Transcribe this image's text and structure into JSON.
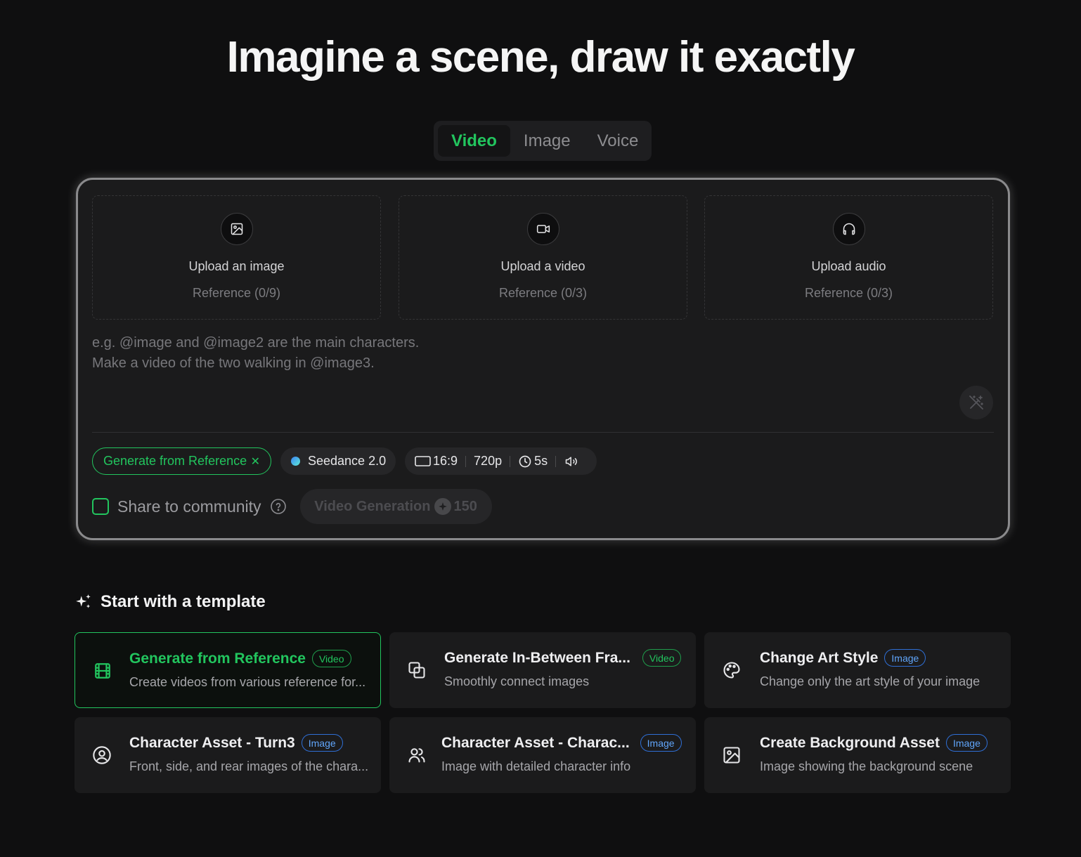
{
  "hero": {
    "title": "Imagine a scene, draw it exactly"
  },
  "tabs": [
    {
      "label": "Video",
      "active": true
    },
    {
      "label": "Image",
      "active": false
    },
    {
      "label": "Voice",
      "active": false
    }
  ],
  "uploads": [
    {
      "icon": "image-icon",
      "title": "Upload an image",
      "subtitle": "Reference (0/9)"
    },
    {
      "icon": "video-camera-icon",
      "title": "Upload a video",
      "subtitle": "Reference (0/3)"
    },
    {
      "icon": "headphones-icon",
      "title": "Upload audio",
      "subtitle": "Reference (0/3)"
    }
  ],
  "prompt": {
    "placeholder": "e.g. @image and @image2 are the main characters.\nMake a video of the two walking in @image3.",
    "enhance_icon": "magic-wand-icon"
  },
  "options": {
    "mode_label": "Generate from Reference",
    "mode_remove": "✕",
    "model_label": "Seedance 2.0",
    "aspect_ratio": "16:9",
    "resolution": "720p",
    "duration": "5s"
  },
  "share": {
    "label": "Share to community",
    "checked": false
  },
  "generate": {
    "label": "Video Generation",
    "credits": "150"
  },
  "templates": {
    "header": "Start with a template",
    "cards": [
      {
        "icon": "film-icon",
        "title": "Generate from Reference",
        "badge": "Video",
        "desc": "Create videos from various reference for...",
        "selected": true
      },
      {
        "icon": "frames-icon",
        "title": "Generate In-Between Fra...",
        "badge": "Video",
        "desc": "Smoothly connect images",
        "selected": false
      },
      {
        "icon": "palette-icon",
        "title": "Change Art Style",
        "badge": "Image",
        "desc": "Change only the art style of your image",
        "selected": false
      },
      {
        "icon": "user-circle-icon",
        "title": "Character Asset - Turn3",
        "badge": "Image",
        "desc": "Front, side, and rear images of the chara...",
        "selected": false
      },
      {
        "icon": "users-icon",
        "title": "Character Asset - Charac...",
        "badge": "Image",
        "desc": "Image with detailed character info",
        "selected": false
      },
      {
        "icon": "image-icon",
        "title": "Create Background Asset",
        "badge": "Image",
        "desc": "Image showing the background scene",
        "selected": false
      }
    ]
  },
  "colors": {
    "accent": "#22c55e",
    "image_badge": "#60a5fa",
    "background": "#0f0f10",
    "panel": "#1b1b1c"
  }
}
